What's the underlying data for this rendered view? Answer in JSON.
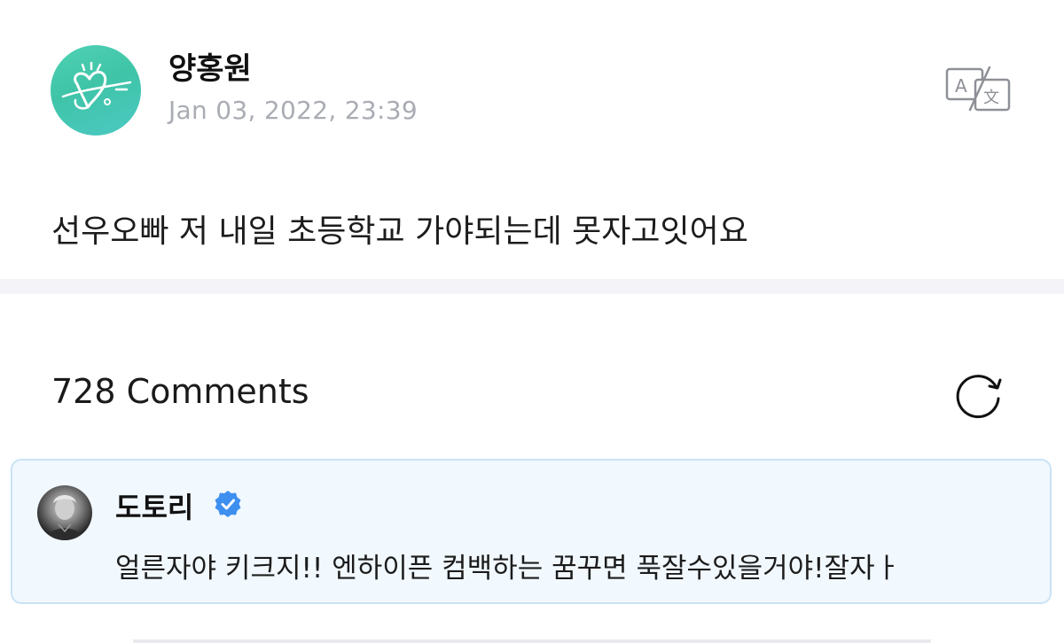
{
  "post": {
    "author": "양홍원",
    "date": "Jan 03, 2022, 23:39",
    "body": "선우오빠 저 내일 초등학교 가야되는데 못자고잇어요",
    "avatar_icon": "heart-doodle-avatar",
    "avatar_color": "#45cbb0",
    "translate_icon": "translate-icon"
  },
  "comments": {
    "count_label": "728 Comments",
    "refresh_icon": "refresh-icon",
    "items": [
      {
        "name": "도토리",
        "verified_icon": "verified-badge-icon",
        "verified_color": "#3d8ff0",
        "text": "얼른자야 키크지!! 엔하이픈 컴백하는 꿈꾸면 푹잘수있을거야!잘자ㅏ",
        "card_bg": "#f1f8fe",
        "card_border": "#c9e3f4"
      }
    ]
  }
}
